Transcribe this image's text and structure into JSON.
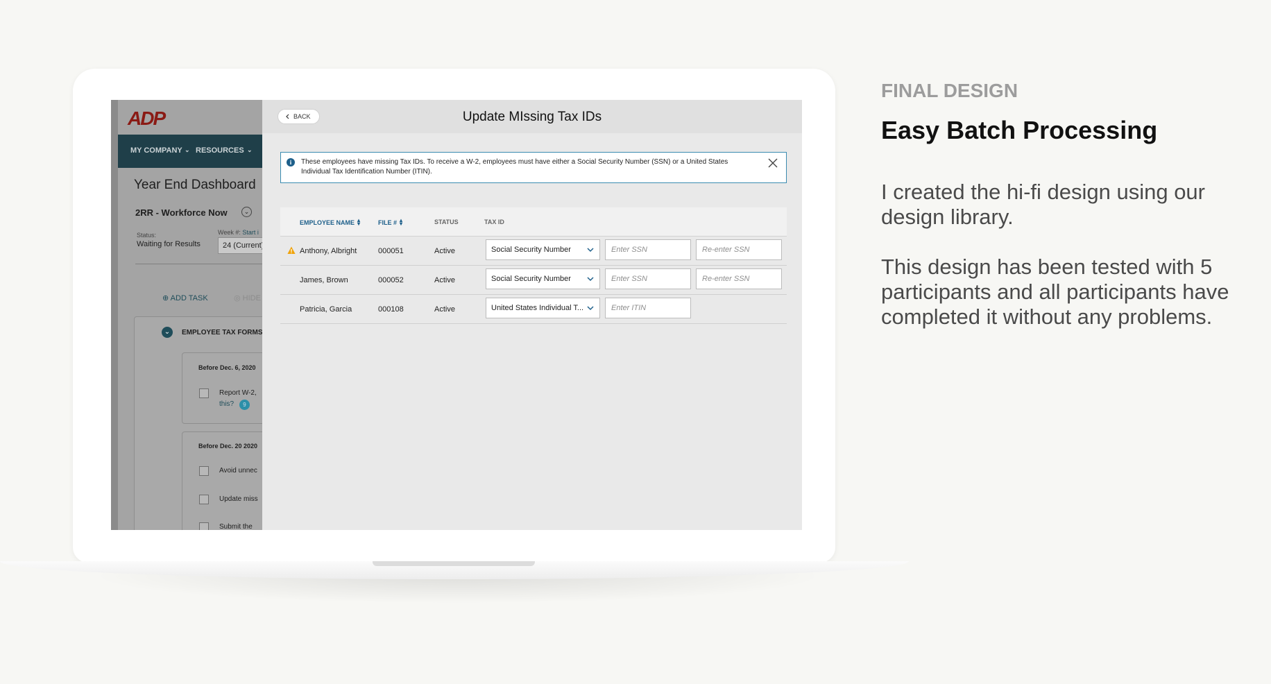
{
  "side": {
    "eyebrow": "FINAL DESIGN",
    "headline": "Easy Batch Processing",
    "paragraph1": "I created the hi-fi design using our design library.",
    "paragraph2": "This design has been tested with 5 participants and all participants have completed it without any problems."
  },
  "background_app": {
    "logo": "ADP",
    "nav": [
      "MY COMPANY",
      "RESOURCES"
    ],
    "page_title": "Year End Dashboard",
    "company": "2RR - Workforce Now",
    "status_label": "Status:",
    "status_value": "Waiting for Results",
    "week_label": "Week #:",
    "week_link": "Start i",
    "week_value": "24 (Current)",
    "add_task": "ADD TASK",
    "hide": "HIDE",
    "section": "EMPLOYEE TAX FORMS",
    "group1_date": "Before Dec. 6, 2020",
    "group1_item": "Report W-2,",
    "group1_link": "this?",
    "group1_badge": "9",
    "group2_date": "Before Dec. 20 2020",
    "group2_items": [
      "Avoid unnec",
      "Update miss",
      "Submit the"
    ]
  },
  "modal": {
    "back_label": "BACK",
    "title": "Update MIssing Tax IDs",
    "info_text": "These employees have missing Tax IDs. To receive a W-2, employees must have either a Social Security Number (SSN) or a United States Individual Tax Identification Number (ITIN).",
    "columns": {
      "name": "EMPLOYEE NAME",
      "file": "FILE #",
      "status": "STATUS",
      "tax_id": "TAX ID"
    },
    "rows": [
      {
        "name": "Anthony, Albright",
        "file": "000051",
        "status": "Active",
        "tax_type": "Social Security Number",
        "field1_placeholder": "Enter SSN",
        "field2_placeholder": "Re-enter SSN",
        "warning": true
      },
      {
        "name": "James, Brown",
        "file": "000052",
        "status": "Active",
        "tax_type": "Social Security Number",
        "field1_placeholder": "Enter SSN",
        "field2_placeholder": "Re-enter SSN",
        "warning": false
      },
      {
        "name": "Patricia, Garcia",
        "file": "000108",
        "status": "Active",
        "tax_type": "United States Individual T...",
        "field1_placeholder": "Enter ITIN",
        "warning": false
      }
    ]
  },
  "colors": {
    "accent": "#1d5f8a",
    "warning": "#f0a30a",
    "nav_bar": "#1f3f49"
  }
}
